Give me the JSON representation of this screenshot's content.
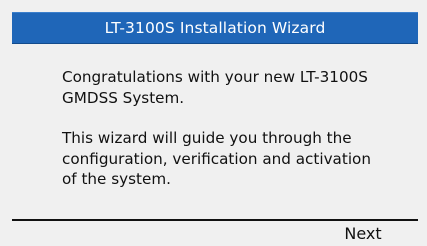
{
  "window": {
    "title": "LT-3100S Installation Wizard"
  },
  "content": {
    "paragraph_1": "Congratulations with your new LT-3100S\nGMDSS System.",
    "paragraph_2": "This wizard will guide you through the\nconfiguration, verification and activation\nof the system."
  },
  "footer": {
    "next_label": "Next"
  },
  "colors": {
    "title_bar": "#1f66b8",
    "background": "#f0f0f0",
    "text": "#111111"
  }
}
